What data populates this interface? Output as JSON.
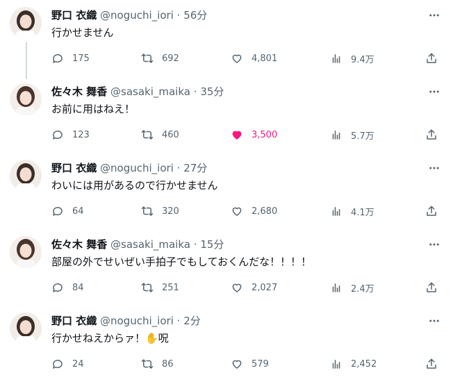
{
  "tweets": [
    {
      "name": "野口 衣織",
      "handle": "@noguchi_iori",
      "time": "56分",
      "text": "行かせません",
      "replies": "175",
      "retweets": "692",
      "likes": "4,801",
      "views": "9.4万",
      "liked": false,
      "thread_line": true
    },
    {
      "name": "佐々木 舞香",
      "handle": "@sasaki_maika",
      "time": "35分",
      "text": "お前に用はねえ！",
      "replies": "123",
      "retweets": "460",
      "likes": "3,500",
      "views": "5.7万",
      "liked": true,
      "thread_line": false
    },
    {
      "name": "野口 衣織",
      "handle": "@noguchi_iori",
      "time": "27分",
      "text": "わいには用があるので行かせません",
      "replies": "64",
      "retweets": "320",
      "likes": "2,680",
      "views": "4.1万",
      "liked": false,
      "thread_line": false
    },
    {
      "name": "佐々木 舞香",
      "handle": "@sasaki_maika",
      "time": "15分",
      "text": "部屋の外でせいぜい手拍子でもしておくんだな！！！！",
      "replies": "84",
      "retweets": "251",
      "likes": "2,027",
      "views": "2.4万",
      "liked": false,
      "thread_line": false
    },
    {
      "name": "野口 衣織",
      "handle": "@noguchi_iori",
      "time": "2分",
      "text": "行かせねえからァ！✋呪",
      "replies": "24",
      "retweets": "86",
      "likes": "579",
      "views": "2,452",
      "liked": false,
      "thread_line": false
    }
  ],
  "separator": "·",
  "icons": {
    "reply": "reply-icon",
    "retweet": "retweet-icon",
    "like": "heart-icon",
    "views": "views-chart-icon",
    "share": "share-icon",
    "more": "more-icon"
  },
  "colors": {
    "like_active": "#f91880",
    "muted": "#536471",
    "text": "#0f1419"
  }
}
